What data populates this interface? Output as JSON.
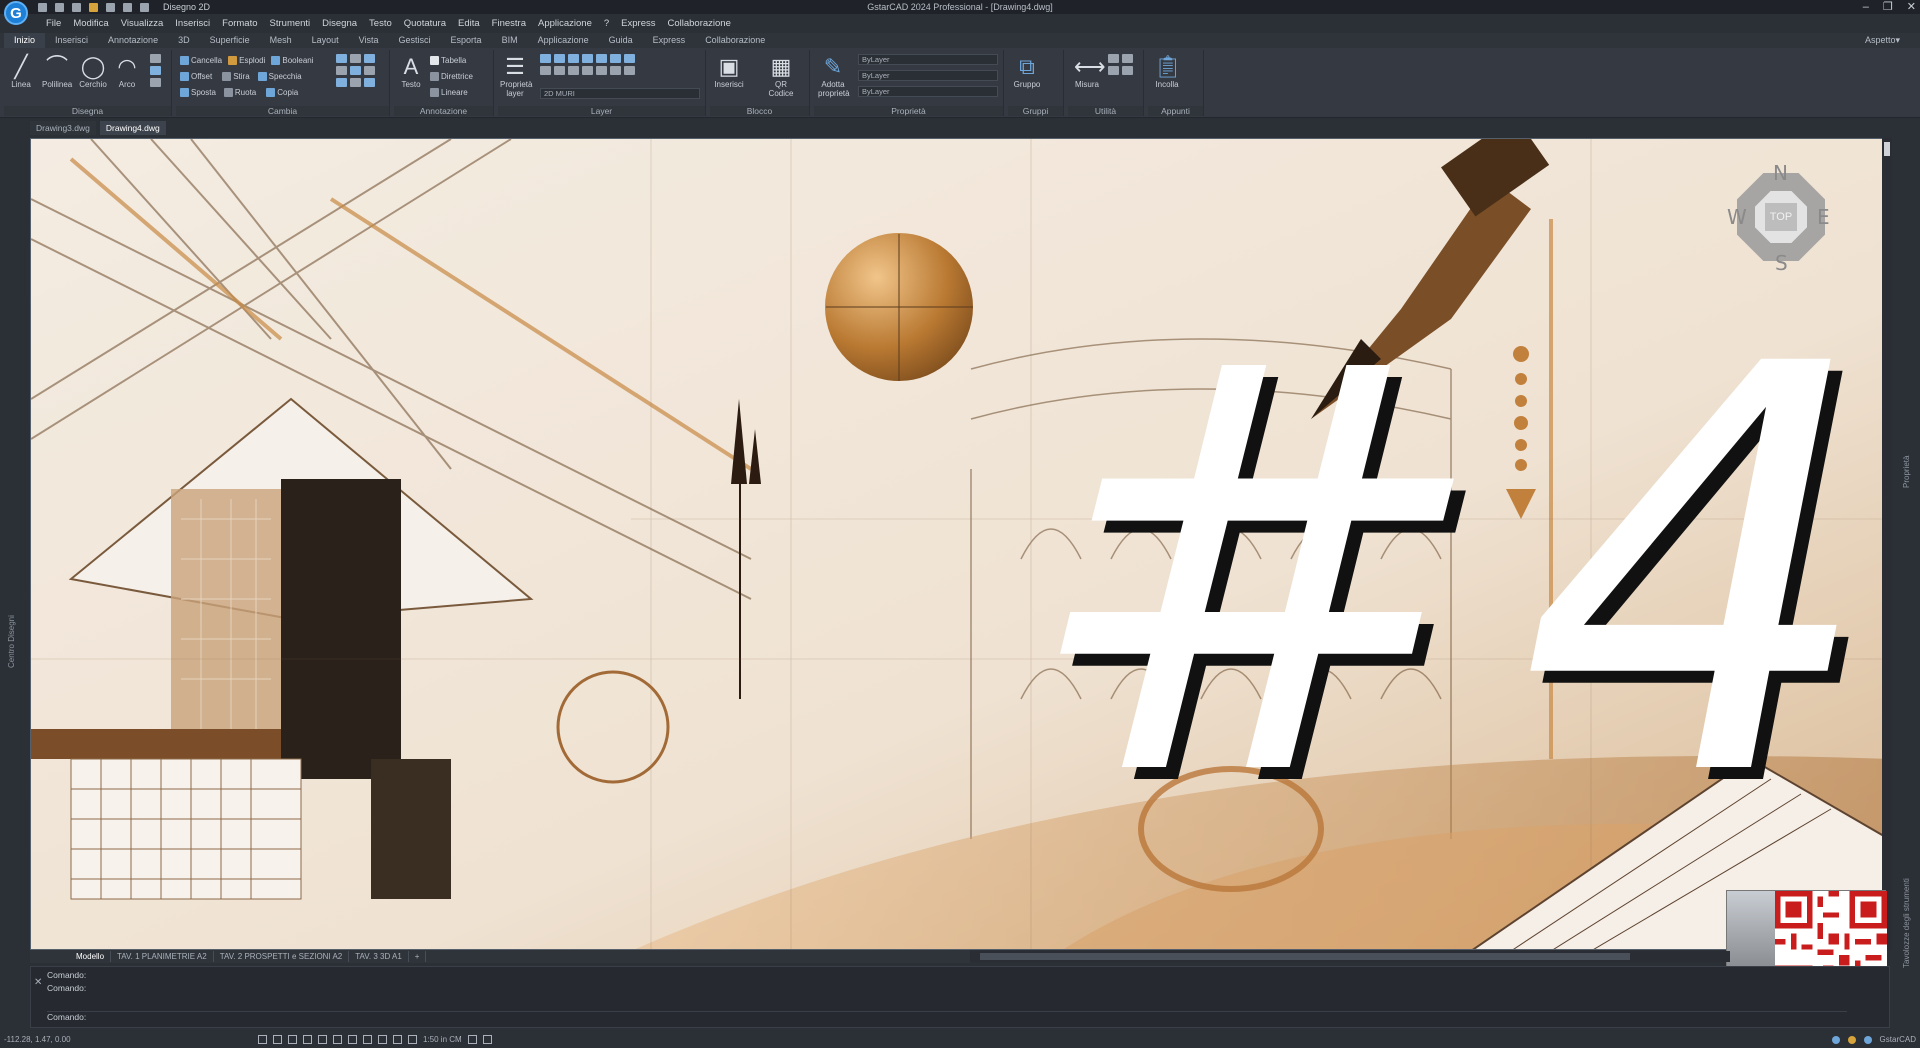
{
  "titlebar": {
    "logo": "G",
    "workspace": "Disegno 2D",
    "title": "GstarCAD 2024 Professional - [Drawing4.dwg]",
    "controls": [
      "–",
      "❐",
      "✕"
    ]
  },
  "menu": [
    "File",
    "Modifica",
    "Visualizza",
    "Inserisci",
    "Formato",
    "Strumenti",
    "Disegna",
    "Testo",
    "Quotatura",
    "Edita",
    "Finestra",
    "Applicazione",
    "?",
    "Express",
    "Collaborazione"
  ],
  "ribbon_tabs": [
    "Inizio",
    "Inserisci",
    "Annotazione",
    "3D",
    "Superficie",
    "Mesh",
    "Layout",
    "Vista",
    "Gestisci",
    "Esporta",
    "BIM",
    "Applicazione",
    "Guida",
    "Express",
    "Collaborazione"
  ],
  "ribbon_tabs_right": "Aspetto▾",
  "ribbon": {
    "disegna": {
      "label": "Disegna",
      "tools": [
        "Linea",
        "Polilinea",
        "Cerchio",
        "Arco"
      ]
    },
    "cambia": {
      "label": "Cambia",
      "rows": [
        [
          "Cancella",
          "Esplodi",
          "Booleani"
        ],
        [
          "Offset",
          "Stira",
          "Specchia"
        ],
        [
          "Sposta",
          "Ruota",
          "Copia"
        ]
      ]
    },
    "annotazione": {
      "label": "Annotazione",
      "tool": "Testo",
      "rows": [
        "Tabella",
        "Direttrice",
        "Lineare"
      ]
    },
    "layer": {
      "label": "Layer",
      "tool": "Proprietà layer",
      "combo": "2D MURI"
    },
    "blocco": {
      "label": "Blocco",
      "tools": [
        "Inserisci",
        "QR Codice"
      ]
    },
    "proprieta": {
      "label": "Proprietà",
      "tool": "Adotta proprietà",
      "combos": [
        "ByLayer",
        "ByLayer",
        "ByLayer"
      ]
    },
    "gruppi": {
      "label": "Gruppi",
      "tool": "Gruppo"
    },
    "utilita": {
      "label": "Utilità",
      "tool": "Misura"
    },
    "appunti": {
      "label": "Appunti",
      "tool": "Incolla"
    }
  },
  "doc_tabs": [
    "Drawing3.dwg",
    "Drawing4.dwg"
  ],
  "canvas": {
    "big_text": "#4"
  },
  "viewcube": {
    "top": "TOP",
    "n": "N",
    "s": "S",
    "e": "E",
    "w": "W"
  },
  "left_panel": "Centro Disegni",
  "right_panels": [
    "Proprietà",
    "Tavolozze degli strumenti"
  ],
  "layout_tabs": [
    "Modello",
    "TAV. 1 PLANIMETRIE A2",
    "TAV. 2 PROSPETTI e SEZIONI A2",
    "TAV. 3 3D A1",
    "+"
  ],
  "command": {
    "lines": [
      "Comando:",
      "Comando:"
    ],
    "prompt": "Comando:"
  },
  "status": {
    "coords": "-112.28, 1.47, 0.00",
    "scale": "1:50 in CM",
    "app": "GstarCAD"
  }
}
